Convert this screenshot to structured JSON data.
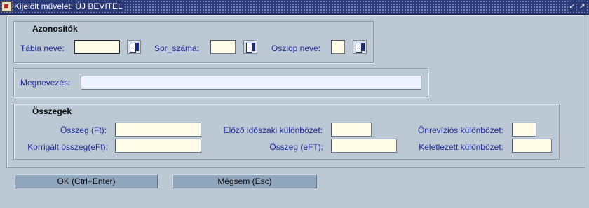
{
  "window": {
    "title": "Kijelölt művelet: ÚJ BEVITEL",
    "controls": {
      "restore": "↙",
      "maximize": "↗"
    }
  },
  "azonositok": {
    "title": "Azonosítók",
    "tabla_label": "Tábla neve:",
    "tabla_value": "",
    "sor_label": "Sor_száma:",
    "sor_value": "",
    "oszlop_label": "Oszlop neve:",
    "oszlop_value": ""
  },
  "megnevezes": {
    "label": "Megnevezés:",
    "value": ""
  },
  "osszegek": {
    "title": "Összegek",
    "osszeg_ft_label": "Összeg (Ft):",
    "korrigalt_label": "Korrigált összeg(eFt):",
    "elozo_label": "Előző időszaki különbözet:",
    "osszeg_eft_label": "Összeg (eFT):",
    "onrevizios_label": "Önrevíziós különbözet:",
    "keletlezett_label": "Keletlezett különbözet:",
    "values": {
      "osszeg_ft": "",
      "korrigalt": "",
      "elozo": "",
      "osszeg_eft": "",
      "onrevizios": "",
      "keletlezett": ""
    }
  },
  "buttons": {
    "ok_label": "OK (Ctrl+Enter)",
    "cancel_label": "Mégsem (Esc)"
  }
}
